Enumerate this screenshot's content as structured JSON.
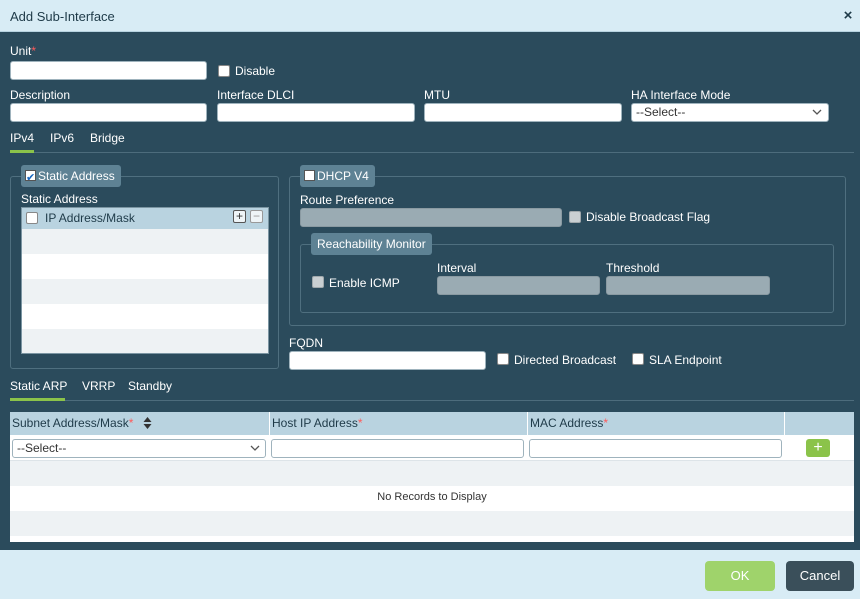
{
  "dialog": {
    "title": "Add Sub-Interface",
    "close_symbol": "×"
  },
  "unit": {
    "label": "Unit",
    "required": "*",
    "value": ""
  },
  "disable": {
    "label": "Disable",
    "checked": false
  },
  "description": {
    "label": "Description",
    "value": ""
  },
  "interface_dlci": {
    "label": "Interface DLCI",
    "value": ""
  },
  "mtu": {
    "label": "MTU",
    "value": ""
  },
  "ha_mode": {
    "label": "HA Interface Mode",
    "value": "--Select--"
  },
  "proto_tabs": [
    {
      "label": "IPv4",
      "active": true
    },
    {
      "label": "IPv6",
      "active": false
    },
    {
      "label": "Bridge",
      "active": false
    }
  ],
  "static": {
    "legend": "Static Address",
    "checked": true,
    "title": "Static Address",
    "grid_header": "IP Address/Mask",
    "add_symbol": "+",
    "remove_symbol": "−"
  },
  "dhcp": {
    "legend": "DHCP V4",
    "checked": false,
    "route_pref_label": "Route Preference",
    "disable_bcast_label": "Disable Broadcast Flag",
    "reach_legend": "Reachability Monitor",
    "enable_icmp_label": "Enable ICMP",
    "interval_label": "Interval",
    "threshold_label": "Threshold"
  },
  "fqdn": {
    "label": "FQDN",
    "value": ""
  },
  "directed_broadcast": {
    "label": "Directed Broadcast",
    "checked": false
  },
  "sla_endpoint": {
    "label": "SLA Endpoint",
    "checked": false
  },
  "arp_tabs": [
    {
      "label": "Static ARP",
      "active": true
    },
    {
      "label": "VRRP",
      "active": false
    },
    {
      "label": "Standby",
      "active": false
    }
  ],
  "arp_table": {
    "columns": [
      "Subnet Address/Mask",
      "Host IP Address",
      "MAC Address",
      ""
    ],
    "required": "*",
    "sort_icon": "sort-icon",
    "subnet_select": "--Select--",
    "add_symbol": "+",
    "empty_text": "No Records to Display"
  },
  "footer": {
    "ok_label": "OK",
    "cancel_label": "Cancel"
  },
  "colors": {
    "body_bg": "#2b4b5c",
    "header_bg": "#d8ecf5",
    "accent_green": "#8bc34a",
    "cancel_bg": "#3a4f5a"
  }
}
